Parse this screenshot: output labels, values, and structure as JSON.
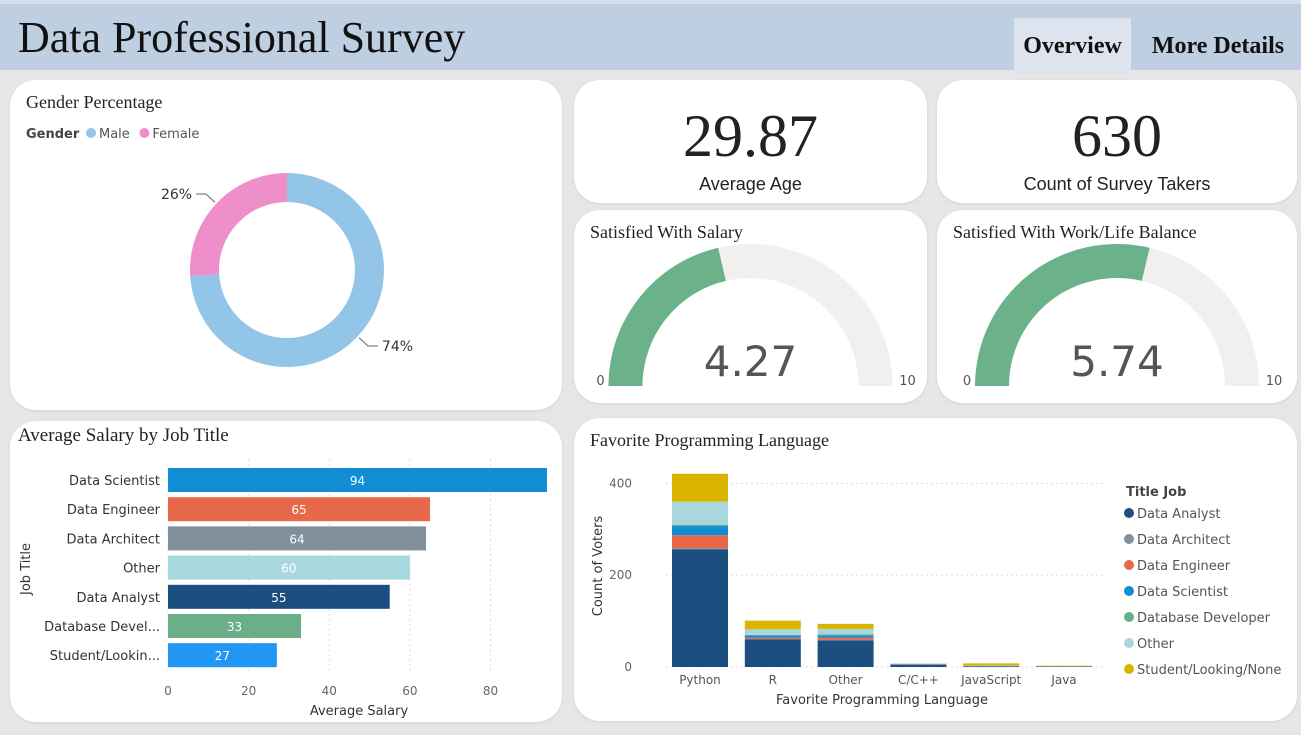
{
  "header": {
    "title": "Data Professional Survey",
    "tabs": [
      {
        "label": "Overview",
        "active": true
      },
      {
        "label": "More Details",
        "active": false
      }
    ],
    "bg_color": "#bfcfe2"
  },
  "gender": {
    "title": "Gender Percentage",
    "legend_title": "Gender",
    "chart_data": {
      "type": "pie",
      "categories": [
        "Male",
        "Female"
      ],
      "values": [
        74,
        26
      ],
      "labels": [
        "74%",
        "26%"
      ],
      "colors": [
        "#93c5e8",
        "#ee8fc9"
      ],
      "legend": "top-left"
    }
  },
  "kpis": [
    {
      "value": "29.87",
      "label": "Average Age"
    },
    {
      "value": "630",
      "label": "Count of Survey Takers"
    }
  ],
  "gauges": [
    {
      "title": "Satisfied With Salary",
      "value": 4.27,
      "display": "4.27",
      "min": 0,
      "max": 10,
      "min_label": "0",
      "max_label": "10"
    },
    {
      "title": "Satisfied With Work/Life Balance",
      "value": 5.74,
      "display": "5.74",
      "min": 0,
      "max": 10,
      "min_label": "0",
      "max_label": "10"
    }
  ],
  "salary": {
    "title": "Average Salary by Job Title",
    "chart_data": {
      "type": "bar",
      "orientation": "horizontal",
      "categories": [
        "Data Scientist",
        "Data Engineer",
        "Data Architect",
        "Other",
        "Data Analyst",
        "Database Devel...",
        "Student/Lookin..."
      ],
      "values": [
        94,
        65,
        64,
        60,
        55,
        33,
        27
      ],
      "value_labels": [
        "94",
        "65",
        "64",
        "60",
        "55",
        "33",
        "27"
      ],
      "colors": [
        "#118dd4",
        "#e8694a",
        "#808f9a",
        "#a8d8de",
        "#1c4e80",
        "#6aaf88",
        "#2196f3"
      ],
      "xlabel": "Average Salary",
      "ylabel": "Job Title",
      "xlim": [
        0,
        95
      ],
      "xticks": [
        "0",
        "20",
        "40",
        "60",
        "80"
      ],
      "xtick_values": [
        0,
        20,
        40,
        60,
        80
      ],
      "grid": true
    }
  },
  "languages": {
    "title": "Favorite Programming Language",
    "chart_data": {
      "type": "bar",
      "stacked": true,
      "categories": [
        "Python",
        "R",
        "Other",
        "C/C++",
        "JavaScript",
        "Java"
      ],
      "series": [
        {
          "name": "Data Analyst",
          "color": "#1c4e80",
          "values": [
            256,
            60,
            58,
            5,
            1,
            1
          ]
        },
        {
          "name": "Data Architect",
          "color": "#808f9a",
          "values": [
            3,
            1,
            1,
            0,
            0,
            0
          ]
        },
        {
          "name": "Data Engineer",
          "color": "#e8694a",
          "values": [
            28,
            3,
            5,
            1,
            0,
            0
          ]
        },
        {
          "name": "Data Scientist",
          "color": "#118dd4",
          "values": [
            20,
            5,
            5,
            1,
            1,
            0
          ]
        },
        {
          "name": "Database Developer",
          "color": "#6aaf88",
          "values": [
            3,
            1,
            2,
            0,
            0,
            0
          ]
        },
        {
          "name": "Other",
          "color": "#a8d8de",
          "values": [
            50,
            12,
            12,
            0,
            1,
            1
          ]
        },
        {
          "name": "Student/Looking/None",
          "color": "#dbb400",
          "values": [
            61,
            19,
            11,
            0,
            5,
            1
          ]
        }
      ],
      "legend_title": "Title Job",
      "xlabel": "Favorite Programming Language",
      "ylabel": "Count of Voters",
      "ylim": [
        0,
        440
      ],
      "yticks": [
        "0",
        "200",
        "400"
      ],
      "ytick_values": [
        0,
        200,
        400
      ],
      "legend": "right",
      "grid": true
    }
  }
}
